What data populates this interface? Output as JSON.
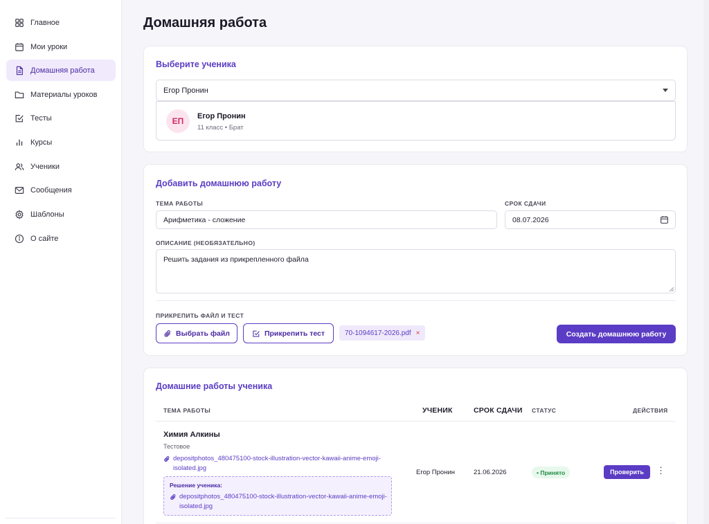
{
  "sidebar": {
    "items": [
      {
        "label": "Главное",
        "icon": "grid-icon"
      },
      {
        "label": "Мои уроки",
        "icon": "calendar-icon"
      },
      {
        "label": "Домашняя работа",
        "icon": "document-icon",
        "active": true
      },
      {
        "label": "Материалы уроков",
        "icon": "folder-icon"
      },
      {
        "label": "Тесты",
        "icon": "checkbox-icon"
      },
      {
        "label": "Курсы",
        "icon": "bar-chart-icon"
      },
      {
        "label": "Ученики",
        "icon": "users-icon"
      },
      {
        "label": "Сообщения",
        "icon": "mail-icon"
      },
      {
        "label": "Шаблоны",
        "icon": "gear-icon"
      },
      {
        "label": "О сайте",
        "icon": "info-icon"
      }
    ]
  },
  "page": {
    "title": "Домашняя работа"
  },
  "select_student": {
    "title": "Выберите ученика",
    "selected": "Егор Пронин",
    "card": {
      "initials": "ЕП",
      "name": "Егор Пронин",
      "meta": "11 класс • Брат"
    }
  },
  "add_homework": {
    "title": "Добавить домашнюю работу",
    "topic_label": "ТЕМА РАБОТЫ",
    "topic_value": "Арифметика - сложение",
    "deadline_label": "СРОК СДАЧИ",
    "deadline_value": "08.07.2026",
    "description_label": "ОПИСАНИЕ (НЕОБЯЗАТЕЛЬНО)",
    "description_value": "Решить задания из прикрепленного файла",
    "attach_label": "ПРИКРЕПИТЬ ФАЙЛ И ТЕСТ",
    "choose_file": "Выбрать файл",
    "attach_test": "Прикрепить тест",
    "attached_file": "70-1094617-2026.pdf",
    "remove_symbol": "×",
    "create_button": "Создать домашнюю работу"
  },
  "student_homeworks": {
    "title": "Домашние работы ученика",
    "columns": {
      "topic": "ТЕМА РАБОТЫ",
      "student": "УЧЕНИК",
      "deadline": "СРОК СДАЧИ",
      "status": "СТАТУС",
      "actions": "ДЕЙСТВИЯ"
    },
    "rows": [
      {
        "title": "Химия Алкины",
        "subtitle": "Тестовое",
        "attachment": "depositphotos_480475100-stock-illustration-vector-kawaii-anime-emoji-isolated.jpg",
        "solution_label": "Решение ученика:",
        "solution_file": "depositphotos_480475100-stock-illustration-vector-kawaii-anime-emoji-isolated.jpg",
        "student": "Егор Пронин",
        "deadline": "21.06.2026",
        "status": "• Принято",
        "check_button": "Проверить",
        "more": "⋮"
      }
    ]
  },
  "colors": {
    "accent": "#5b3cc4",
    "status_ok": "#208a42",
    "avatar": "#d02c63"
  }
}
